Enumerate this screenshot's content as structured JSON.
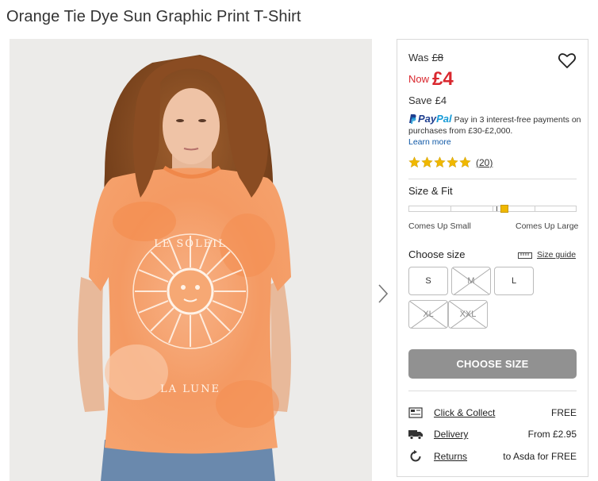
{
  "product": {
    "title": "Orange Tie Dye Sun Graphic Print T-Shirt"
  },
  "image": {
    "shirt_print_top": "LE SOLEIL",
    "shirt_print_bottom": "LA LUNE",
    "alt_icon": "product-photo"
  },
  "price": {
    "was_label": "Was",
    "was_value": "£8",
    "now_label": "Now",
    "now_value": "£4",
    "save_label": "Save",
    "save_value": "£4",
    "now_color": "#d9272e"
  },
  "paypal": {
    "logo_pay": "Pay",
    "logo_pal": "Pal",
    "message": "Pay in 3 interest-free payments on purchases from £30-£2,000.",
    "learn_more": "Learn more"
  },
  "rating": {
    "stars": 5,
    "count": "(20)",
    "star_color": "#f0b800"
  },
  "fit": {
    "title": "Size & Fit",
    "left_label": "Comes Up Small",
    "right_label": "Comes Up Large",
    "position": 0.57
  },
  "sizes": {
    "title": "Choose size",
    "guide_label": "Size guide",
    "options": [
      {
        "label": "S",
        "available": true
      },
      {
        "label": "M",
        "available": false
      },
      {
        "label": "L",
        "available": true
      },
      {
        "label": "XL",
        "available": false
      },
      {
        "label": "XXL",
        "available": false
      }
    ]
  },
  "cta": {
    "label": "CHOOSE SIZE"
  },
  "delivery": [
    {
      "icon": "store-icon",
      "label": "Click & Collect",
      "value": "FREE"
    },
    {
      "icon": "truck-icon",
      "label": "Delivery",
      "value": "From £2.95"
    },
    {
      "icon": "returns-icon",
      "label": "Returns",
      "value": "to Asda for FREE"
    }
  ]
}
